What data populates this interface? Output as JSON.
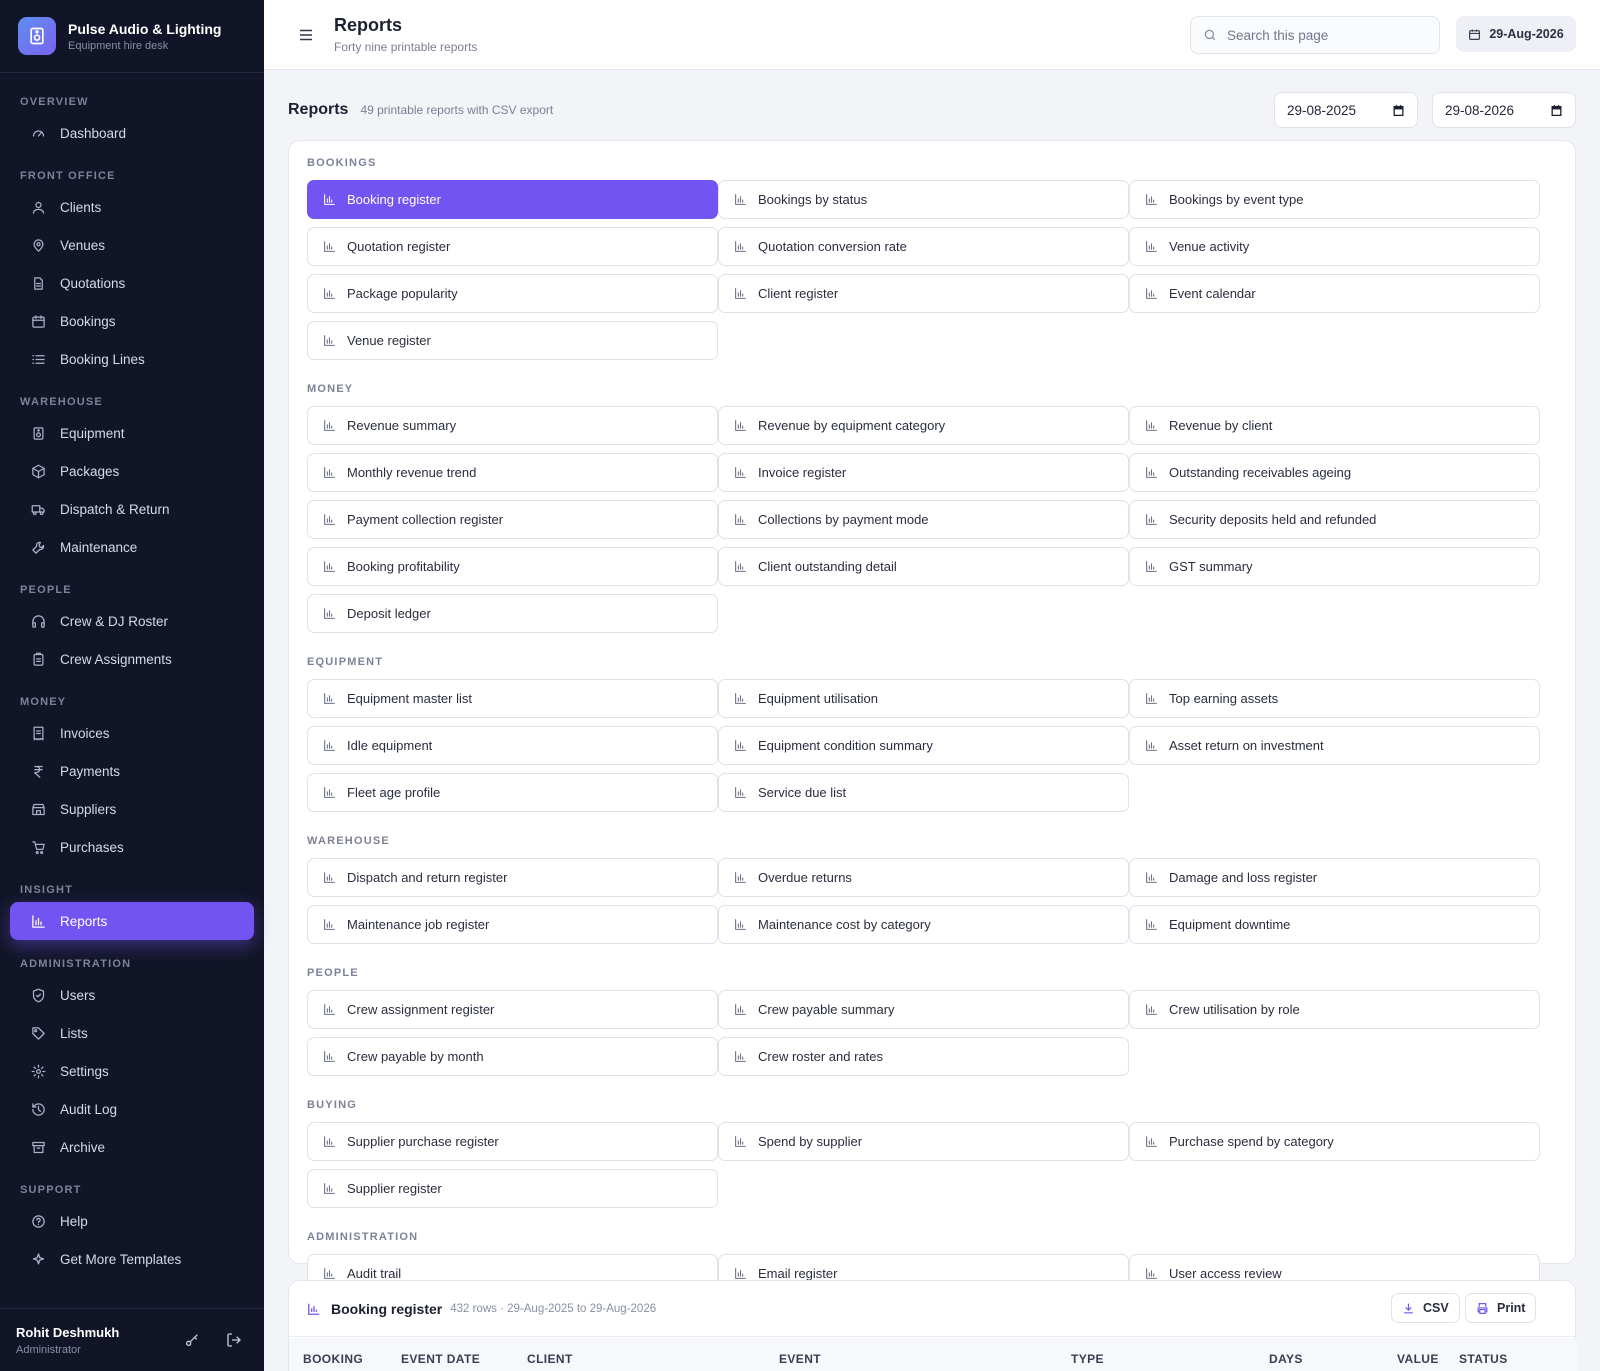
{
  "brand": {
    "name": "Pulse Audio & Lighting",
    "subtitle": "Equipment hire desk"
  },
  "sidebar": {
    "sections": [
      {
        "title": "OVERVIEW",
        "items": [
          {
            "label": "Dashboard",
            "icon": "gauge-icon"
          }
        ]
      },
      {
        "title": "FRONT OFFICE",
        "items": [
          {
            "label": "Clients",
            "icon": "user-icon"
          },
          {
            "label": "Venues",
            "icon": "map-pin-icon"
          },
          {
            "label": "Quotations",
            "icon": "file-icon"
          },
          {
            "label": "Bookings",
            "icon": "calendar-icon"
          },
          {
            "label": "Booking Lines",
            "icon": "list-icon"
          }
        ]
      },
      {
        "title": "WAREHOUSE",
        "items": [
          {
            "label": "Equipment",
            "icon": "speaker-icon"
          },
          {
            "label": "Packages",
            "icon": "box-icon"
          },
          {
            "label": "Dispatch & Return",
            "icon": "truck-icon"
          },
          {
            "label": "Maintenance",
            "icon": "wrench-icon"
          }
        ]
      },
      {
        "title": "PEOPLE",
        "items": [
          {
            "label": "Crew & DJ Roster",
            "icon": "headphones-icon"
          },
          {
            "label": "Crew Assignments",
            "icon": "clipboard-icon"
          }
        ]
      },
      {
        "title": "MONEY",
        "items": [
          {
            "label": "Invoices",
            "icon": "receipt-icon"
          },
          {
            "label": "Payments",
            "icon": "rupee-icon"
          },
          {
            "label": "Suppliers",
            "icon": "store-icon"
          },
          {
            "label": "Purchases",
            "icon": "cart-icon"
          }
        ]
      },
      {
        "title": "INSIGHT",
        "items": [
          {
            "label": "Reports",
            "icon": "bar-chart-icon",
            "active": true
          }
        ]
      },
      {
        "title": "ADMINISTRATION",
        "items": [
          {
            "label": "Users",
            "icon": "shield-icon"
          },
          {
            "label": "Lists",
            "icon": "tag-icon"
          },
          {
            "label": "Settings",
            "icon": "gear-icon"
          },
          {
            "label": "Audit Log",
            "icon": "history-icon"
          },
          {
            "label": "Archive",
            "icon": "archive-icon"
          }
        ]
      },
      {
        "title": "SUPPORT",
        "items": [
          {
            "label": "Help",
            "icon": "help-icon"
          },
          {
            "label": "Get More Templates",
            "icon": "sparkle-icon"
          }
        ]
      }
    ]
  },
  "user": {
    "name": "Rohit Deshmukh",
    "role": "Administrator"
  },
  "topbar": {
    "title": "Reports",
    "subtitle": "Forty nine printable reports",
    "search_placeholder": "Search this page",
    "date": "29-Aug-2026"
  },
  "main": {
    "title": "Reports",
    "subtitle": "49 printable reports with CSV export",
    "date_from": "29-08-2025",
    "date_to": "29-08-2026"
  },
  "report_groups": [
    {
      "title": "BOOKINGS",
      "reports": [
        "Booking register",
        "Bookings by status",
        "Bookings by event type",
        "Quotation register",
        "Quotation conversion rate",
        "Venue activity",
        "Package popularity",
        "Client register",
        "Event calendar",
        "Venue register"
      ]
    },
    {
      "title": "MONEY",
      "reports": [
        "Revenue summary",
        "Revenue by equipment category",
        "Revenue by client",
        "Monthly revenue trend",
        "Invoice register",
        "Outstanding receivables ageing",
        "Payment collection register",
        "Collections by payment mode",
        "Security deposits held and refunded",
        "Booking profitability",
        "Client outstanding detail",
        "GST summary",
        "Deposit ledger"
      ]
    },
    {
      "title": "EQUIPMENT",
      "reports": [
        "Equipment master list",
        "Equipment utilisation",
        "Top earning assets",
        "Idle equipment",
        "Equipment condition summary",
        "Asset return on investment",
        "Fleet age profile",
        "Service due list"
      ]
    },
    {
      "title": "WAREHOUSE",
      "reports": [
        "Dispatch and return register",
        "Overdue returns",
        "Damage and loss register",
        "Maintenance job register",
        "Maintenance cost by category",
        "Equipment downtime"
      ]
    },
    {
      "title": "PEOPLE",
      "reports": [
        "Crew assignment register",
        "Crew payable summary",
        "Crew utilisation by role",
        "Crew payable by month",
        "Crew roster and rates"
      ]
    },
    {
      "title": "BUYING",
      "reports": [
        "Supplier purchase register",
        "Spend by supplier",
        "Purchase spend by category",
        "Supplier register"
      ]
    },
    {
      "title": "ADMINISTRATION",
      "reports": [
        "Audit trail",
        "Email register",
        "User access review"
      ]
    }
  ],
  "selected_report": {
    "title": "Booking register",
    "meta": "432 rows · 29-Aug-2025 to 29-Aug-2026",
    "csv_label": "CSV",
    "print_label": "Print",
    "columns": [
      "BOOKING",
      "EVENT DATE",
      "CLIENT",
      "EVENT",
      "TYPE",
      "DAYS",
      "VALUE",
      "STATUS"
    ]
  },
  "colors": {
    "accent": "#7254f2",
    "sidebar_bg": "#121527"
  }
}
